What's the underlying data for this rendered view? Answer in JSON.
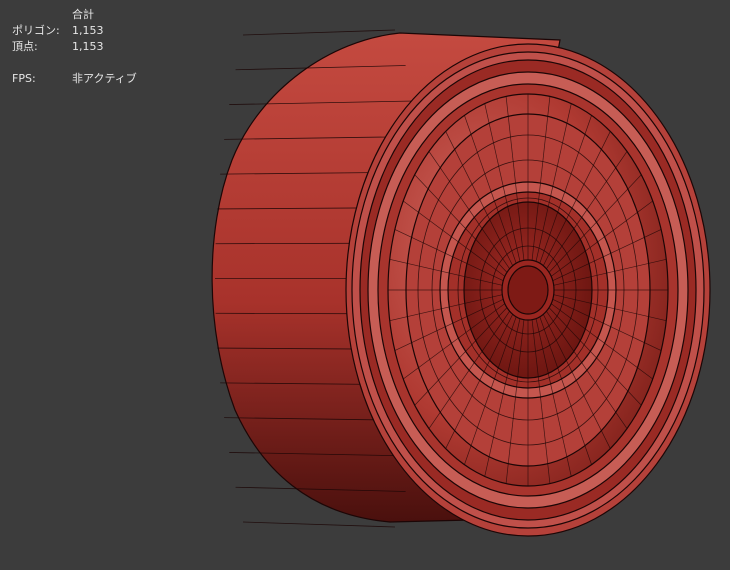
{
  "stats": {
    "header": "合計",
    "polygons_label": "ポリゴン:",
    "polygons_value": "1,153",
    "vertices_label": "頂点:",
    "vertices_value": "1,153",
    "fps_label": "FPS:",
    "fps_value": "非アクティブ"
  },
  "colors": {
    "background": "#3c3c3c",
    "wheel_base": "#b23a32",
    "wheel_dark": "#5a1612",
    "wheel_light": "#d86a60",
    "edge": "#1c0606"
  },
  "viewport": {
    "object": "wheel-mesh"
  }
}
